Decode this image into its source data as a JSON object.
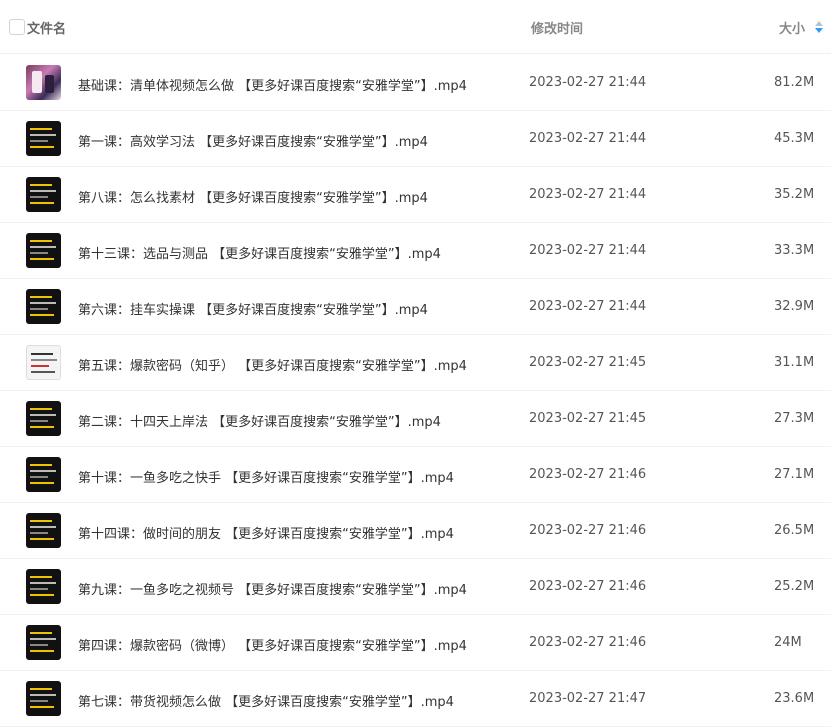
{
  "header": {
    "name_label": "文件名",
    "time_label": "修改时间",
    "size_label": "大小",
    "sort_icon": "sort-descending-icon"
  },
  "files": [
    {
      "name": "基础课：清单体视频怎么做 【更多好课百度搜索“安雅学堂”】.mp4",
      "time": "2023-02-27 21:44",
      "size": "81.2M",
      "thumb": "photo"
    },
    {
      "name": "第一课：高效学习法 【更多好课百度搜索“安雅学堂”】.mp4",
      "time": "2023-02-27 21:44",
      "size": "45.3M",
      "thumb": "dark"
    },
    {
      "name": "第八课：怎么找素材 【更多好课百度搜索“安雅学堂”】.mp4",
      "time": "2023-02-27 21:44",
      "size": "35.2M",
      "thumb": "dark"
    },
    {
      "name": "第十三课：选品与测品 【更多好课百度搜索“安雅学堂”】.mp4",
      "time": "2023-02-27 21:44",
      "size": "33.3M",
      "thumb": "dark"
    },
    {
      "name": "第六课：挂车实操课 【更多好课百度搜索“安雅学堂”】.mp4",
      "time": "2023-02-27 21:44",
      "size": "32.9M",
      "thumb": "dark"
    },
    {
      "name": "第五课：爆款密码（知乎） 【更多好课百度搜索“安雅学堂”】.mp4",
      "time": "2023-02-27 21:45",
      "size": "31.1M",
      "thumb": "light"
    },
    {
      "name": "第二课：十四天上岸法 【更多好课百度搜索“安雅学堂”】.mp4",
      "time": "2023-02-27 21:45",
      "size": "27.3M",
      "thumb": "dark"
    },
    {
      "name": "第十课：一鱼多吃之快手 【更多好课百度搜索“安雅学堂”】.mp4",
      "time": "2023-02-27 21:46",
      "size": "27.1M",
      "thumb": "dark"
    },
    {
      "name": "第十四课：做时间的朋友 【更多好课百度搜索“安雅学堂”】.mp4",
      "time": "2023-02-27 21:46",
      "size": "26.5M",
      "thumb": "dark"
    },
    {
      "name": "第九课：一鱼多吃之视频号 【更多好课百度搜索“安雅学堂”】.mp4",
      "time": "2023-02-27 21:46",
      "size": "25.2M",
      "thumb": "dark"
    },
    {
      "name": "第四课：爆款密码（微博） 【更多好课百度搜索“安雅学堂”】.mp4",
      "time": "2023-02-27 21:46",
      "size": "24M",
      "thumb": "dark"
    },
    {
      "name": "第七课：带货视频怎么做 【更多好课百度搜索“安雅学堂”】.mp4",
      "time": "2023-02-27 21:47",
      "size": "23.6M",
      "thumb": "dark"
    }
  ]
}
